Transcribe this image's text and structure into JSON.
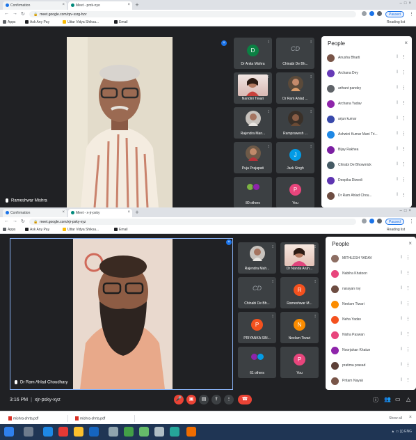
{
  "shot1": {
    "tabs": [
      {
        "label": "Confirmation",
        "active": false
      },
      {
        "label": "Meet - przk-nyo",
        "active": true
      }
    ],
    "url": "meet.google.com/qrv-ssrg-hzv",
    "profile_label": "Paused",
    "bookmarks": [
      "Apps",
      "Ask Any Pay",
      "Uttar Vidya Shiksa...",
      "Email"
    ],
    "bookmarks_right": "Reading list",
    "speaker_name": "Rameshwar Mishra",
    "tiles": [
      {
        "name": "Dr Anita Mishra",
        "initial": "D",
        "color": "#0b8043",
        "type": "initial"
      },
      {
        "name": "Chinabi De Bh...",
        "type": "cd"
      },
      {
        "name": "Nandini Tiwari",
        "type": "photo-woman"
      },
      {
        "name": "Dr Ram Ahlad ...",
        "type": "photo-man"
      },
      {
        "name": "Rajendra Man...",
        "type": "photo-round"
      },
      {
        "name": "Ramprawesh ...",
        "type": "photo-dark"
      },
      {
        "name": "Puja Prajapati",
        "type": "photo-woman2"
      },
      {
        "name": "Jack Singh",
        "initial": "J",
        "color": "#039be5",
        "type": "initial"
      },
      {
        "name": "80 others",
        "type": "others"
      },
      {
        "name": "You",
        "initial": "P",
        "color": "#e8457c",
        "type": "initial"
      }
    ],
    "people_title": "People",
    "people": [
      {
        "name": "Anusha Bharti",
        "color": "#795548"
      },
      {
        "name": "Archana Dey",
        "color": "#673ab7"
      },
      {
        "name": "arihant pandey",
        "color": "#5f6368"
      },
      {
        "name": "Archana Yadav",
        "color": "#8e24aa"
      },
      {
        "name": "arjun kumar",
        "color": "#3949ab"
      },
      {
        "name": "Ashwini Kumar Mani Tri...",
        "color": "#1e88e5"
      },
      {
        "name": "Bijay Rakhea",
        "color": "#7b1fa2"
      },
      {
        "name": "Chirabi De Bhowmick",
        "color": "#455a64"
      },
      {
        "name": "Deepika Diwedi",
        "color": "#5e35b1"
      },
      {
        "name": "Dr Ram Ahlad Chou...",
        "color": "#6d4c41"
      }
    ]
  },
  "shot2": {
    "tabs": [
      {
        "label": "Confirmation",
        "active": false
      },
      {
        "label": "Meet - x-jr-psky",
        "active": true
      }
    ],
    "url": "meet.google.com/xjr-psky-xyz",
    "profile_label": "Paused",
    "bookmarks": [
      "Apps",
      "Ask Any Pay",
      "Uttar Vidya Shiksa...",
      "Email"
    ],
    "bookmarks_right": "Reading list",
    "speaker_name": "Dr Ram Ahlad Choudhary",
    "tiles": [
      {
        "name": "Rajendra Mah...",
        "type": "photo-round"
      },
      {
        "name": "Dr Nanda Aruh...",
        "type": "photo-woman"
      },
      {
        "name": "Chinabi De Bh...",
        "type": "cd"
      },
      {
        "name": "Rameshwar M...",
        "initial": "R",
        "color": "#f4511e",
        "type": "initial"
      },
      {
        "name": "PRIYANKA SIN...",
        "initial": "P",
        "color": "#f4511e",
        "type": "initial"
      },
      {
        "name": "Neelam Tiwari",
        "initial": "N",
        "color": "#fb8c00",
        "type": "initial"
      },
      {
        "name": "61 others",
        "type": "others"
      },
      {
        "name": "You",
        "initial": "P",
        "color": "#e8457c",
        "type": "initial"
      }
    ],
    "people_title": "People",
    "people": [
      {
        "name": "MITHLESH YADAV",
        "color": "#8d6e63"
      },
      {
        "name": "Nabiha Khatoon",
        "color": "#e8457c"
      },
      {
        "name": "narayan roy",
        "color": "#6d4c41"
      },
      {
        "name": "Neelam Tiwari",
        "color": "#fb8c00"
      },
      {
        "name": "Neha Yadav",
        "color": "#f4511e"
      },
      {
        "name": "Nisha Paswan",
        "color": "#e8457c"
      },
      {
        "name": "Noorjahan Khatun",
        "color": "#8e24aa"
      },
      {
        "name": "pratima prasad",
        "color": "#5d4037"
      },
      {
        "name": "Pritam Nayak",
        "color": "#795548"
      }
    ],
    "clock": "3:16 PM",
    "meeting_code": "xjr-psky-xyz",
    "downloads": [
      "mishra-shrta.pdf",
      "mishra-shrta.pdf"
    ],
    "show_all": "Show all"
  }
}
